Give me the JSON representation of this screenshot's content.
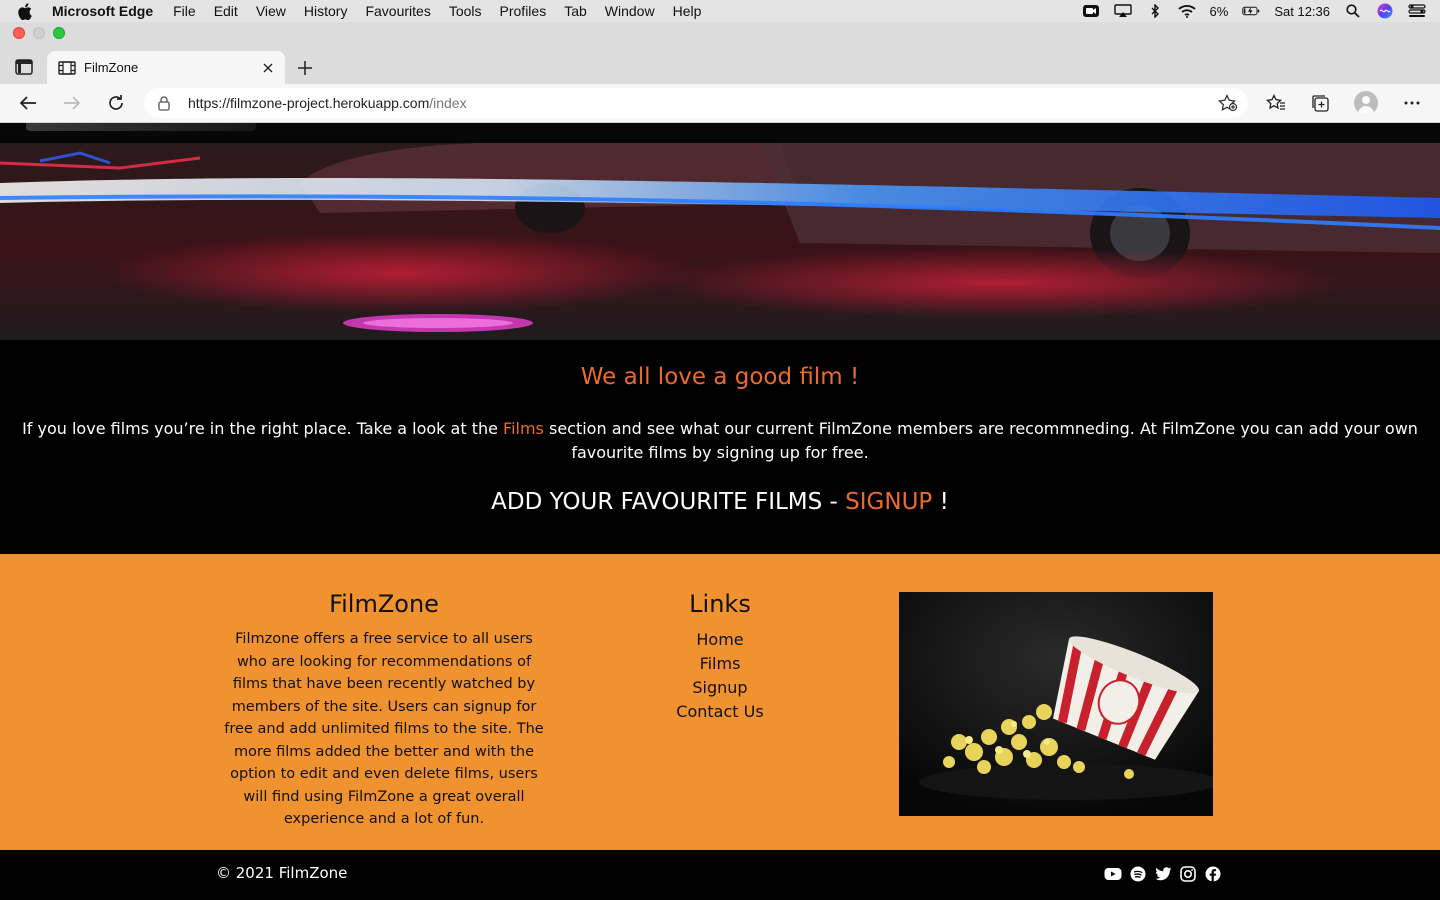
{
  "menubar": {
    "app_name": "Microsoft Edge",
    "items": [
      "File",
      "Edit",
      "View",
      "History",
      "Favourites",
      "Tools",
      "Profiles",
      "Tab",
      "Window",
      "Help"
    ],
    "battery": "6%",
    "clock": "Sat 12:36"
  },
  "browser": {
    "tab_title": "FilmZone",
    "url_main": "https://filmzone-project.herokuapp.com",
    "url_path": "/index"
  },
  "intro": {
    "heading": "We all love a good film !",
    "para_before": "If you love films you’re in the right place. Take a look at the ",
    "para_link": "Films",
    "para_after": " section and see what our current FilmZone members are recommneding. At FilmZone you can add your own favourite films by signing up for free.",
    "cta_before": "ADD YOUR FAVOURITE FILMS - ",
    "cta_link": "SIGNUP",
    "cta_after": " !"
  },
  "footer": {
    "about_title": "FilmZone",
    "about_text": "Filmzone offers a free service to all users who are looking for recommendations of films that have been recently watched by members of the site. Users can signup for free and add unlimited films to the site. The more films added the better and with the option to edit and even delete films, users will find using FilmZone a great overall experience and a lot of fun.",
    "links_title": "Links",
    "links": [
      "Home",
      "Films",
      "Signup",
      "Contact Us"
    ],
    "copyright": "© 2021 FilmZone"
  },
  "colors": {
    "accent": "#ea6b2c",
    "footer_bg": "#ef922f"
  }
}
